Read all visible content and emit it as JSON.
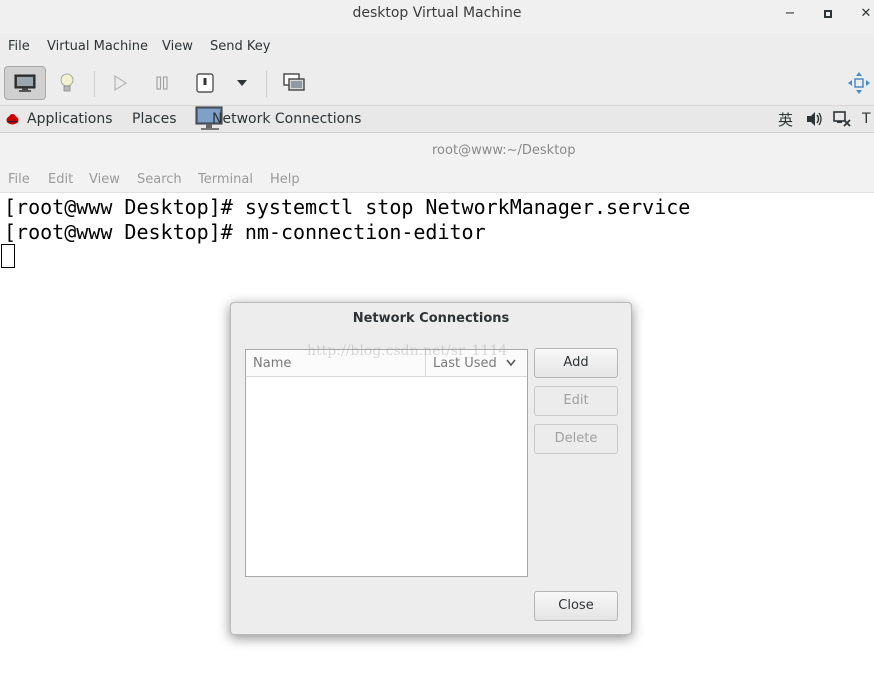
{
  "window": {
    "title": "desktop Virtual Machine",
    "minimize": "−",
    "close": "✕"
  },
  "menubar": {
    "items": [
      "File",
      "Virtual Machine",
      "View",
      "Send Key"
    ]
  },
  "toolbar": {
    "buttons": [
      "screen-icon",
      "lightbulb-icon",
      "play-icon",
      "pause-icon",
      "power-icon",
      "chevron-down-icon",
      "monitors-icon",
      "fullscreen-icon"
    ]
  },
  "guest_panel": {
    "applications": "Applications",
    "places": "Places",
    "task": "Network Connections",
    "lang": "英",
    "trailing": "T"
  },
  "terminal": {
    "title": "root@www:~/Desktop",
    "menu": [
      "File",
      "Edit",
      "View",
      "Search",
      "Terminal",
      "Help"
    ],
    "lines": [
      "[root@www Desktop]# systemctl stop NetworkManager.service",
      "[root@www Desktop]# nm-connection-editor"
    ]
  },
  "dialog": {
    "title": "Network Connections",
    "columns": {
      "name": "Name",
      "last_used": "Last Used"
    },
    "watermark": "http://blog.csdn.net/sr_1114",
    "buttons": {
      "add": "Add",
      "edit": "Edit",
      "delete": "Delete",
      "close": "Close"
    }
  },
  "colors": {
    "dialog_bg": "#ededed",
    "panel_bg": "#e8e8e8",
    "redhat": "#cc0000"
  }
}
